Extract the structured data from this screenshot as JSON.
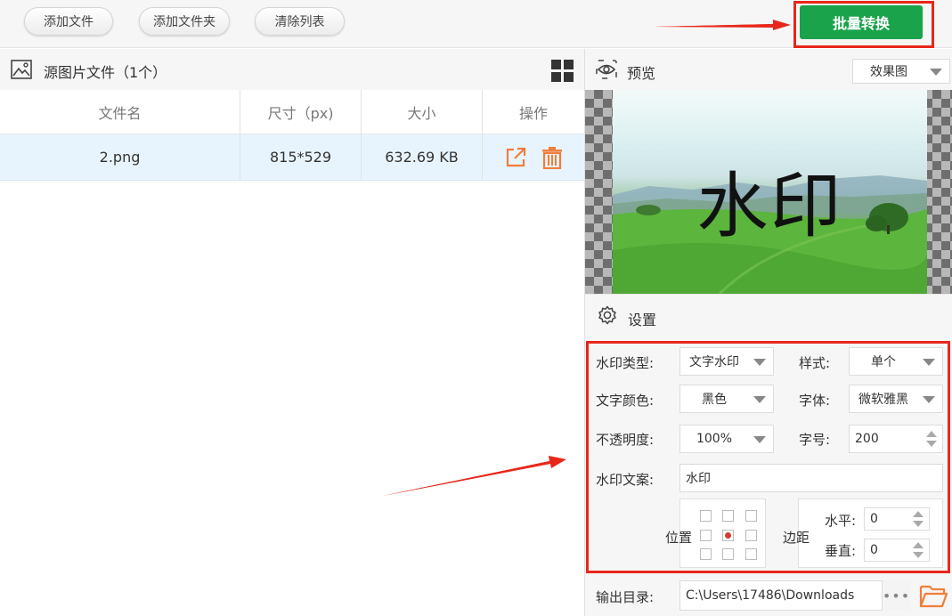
{
  "toolbar": {
    "add_file": "添加文件",
    "add_folder": "添加文件夹",
    "clear_list": "清除列表",
    "batch_convert": "批量转换"
  },
  "files": {
    "title": "源图片文件（1个）",
    "columns": [
      "文件名",
      "尺寸（px)",
      "大小",
      "操作"
    ],
    "rows": [
      {
        "name": "2.png",
        "size_px": "815*529",
        "file_size": "632.69 KB"
      }
    ]
  },
  "preview": {
    "title": "预览",
    "view_mode": "效果图",
    "watermark_text": "水印"
  },
  "settings": {
    "title": "设置",
    "watermark_type_label": "水印类型:",
    "watermark_type_value": "文字水印",
    "style_label": "样式:",
    "style_value": "单个",
    "text_color_label": "文字颜色:",
    "text_color_value": "黑色",
    "font_label": "字体:",
    "font_value": "微软雅黑",
    "opacity_label": "不透明度:",
    "opacity_value": "100%",
    "font_size_label": "字号:",
    "font_size_value": "200",
    "text_label": "水印文案:",
    "text_value": "水印",
    "position_label": "位置",
    "margin_label": "边距",
    "horizontal_label": "水平:",
    "horizontal_value": "0",
    "vertical_label": "垂直:",
    "vertical_value": "0",
    "position_selected": "center"
  },
  "output": {
    "label": "输出目录:",
    "path": "C:\\Users\\17486\\Downloads",
    "browse": "•••"
  },
  "colors": {
    "convert_button": "#1aa34a",
    "highlight_box": "#e8271b",
    "action_icons": "#f07e3a",
    "selected_row": "#e8f4fd"
  }
}
